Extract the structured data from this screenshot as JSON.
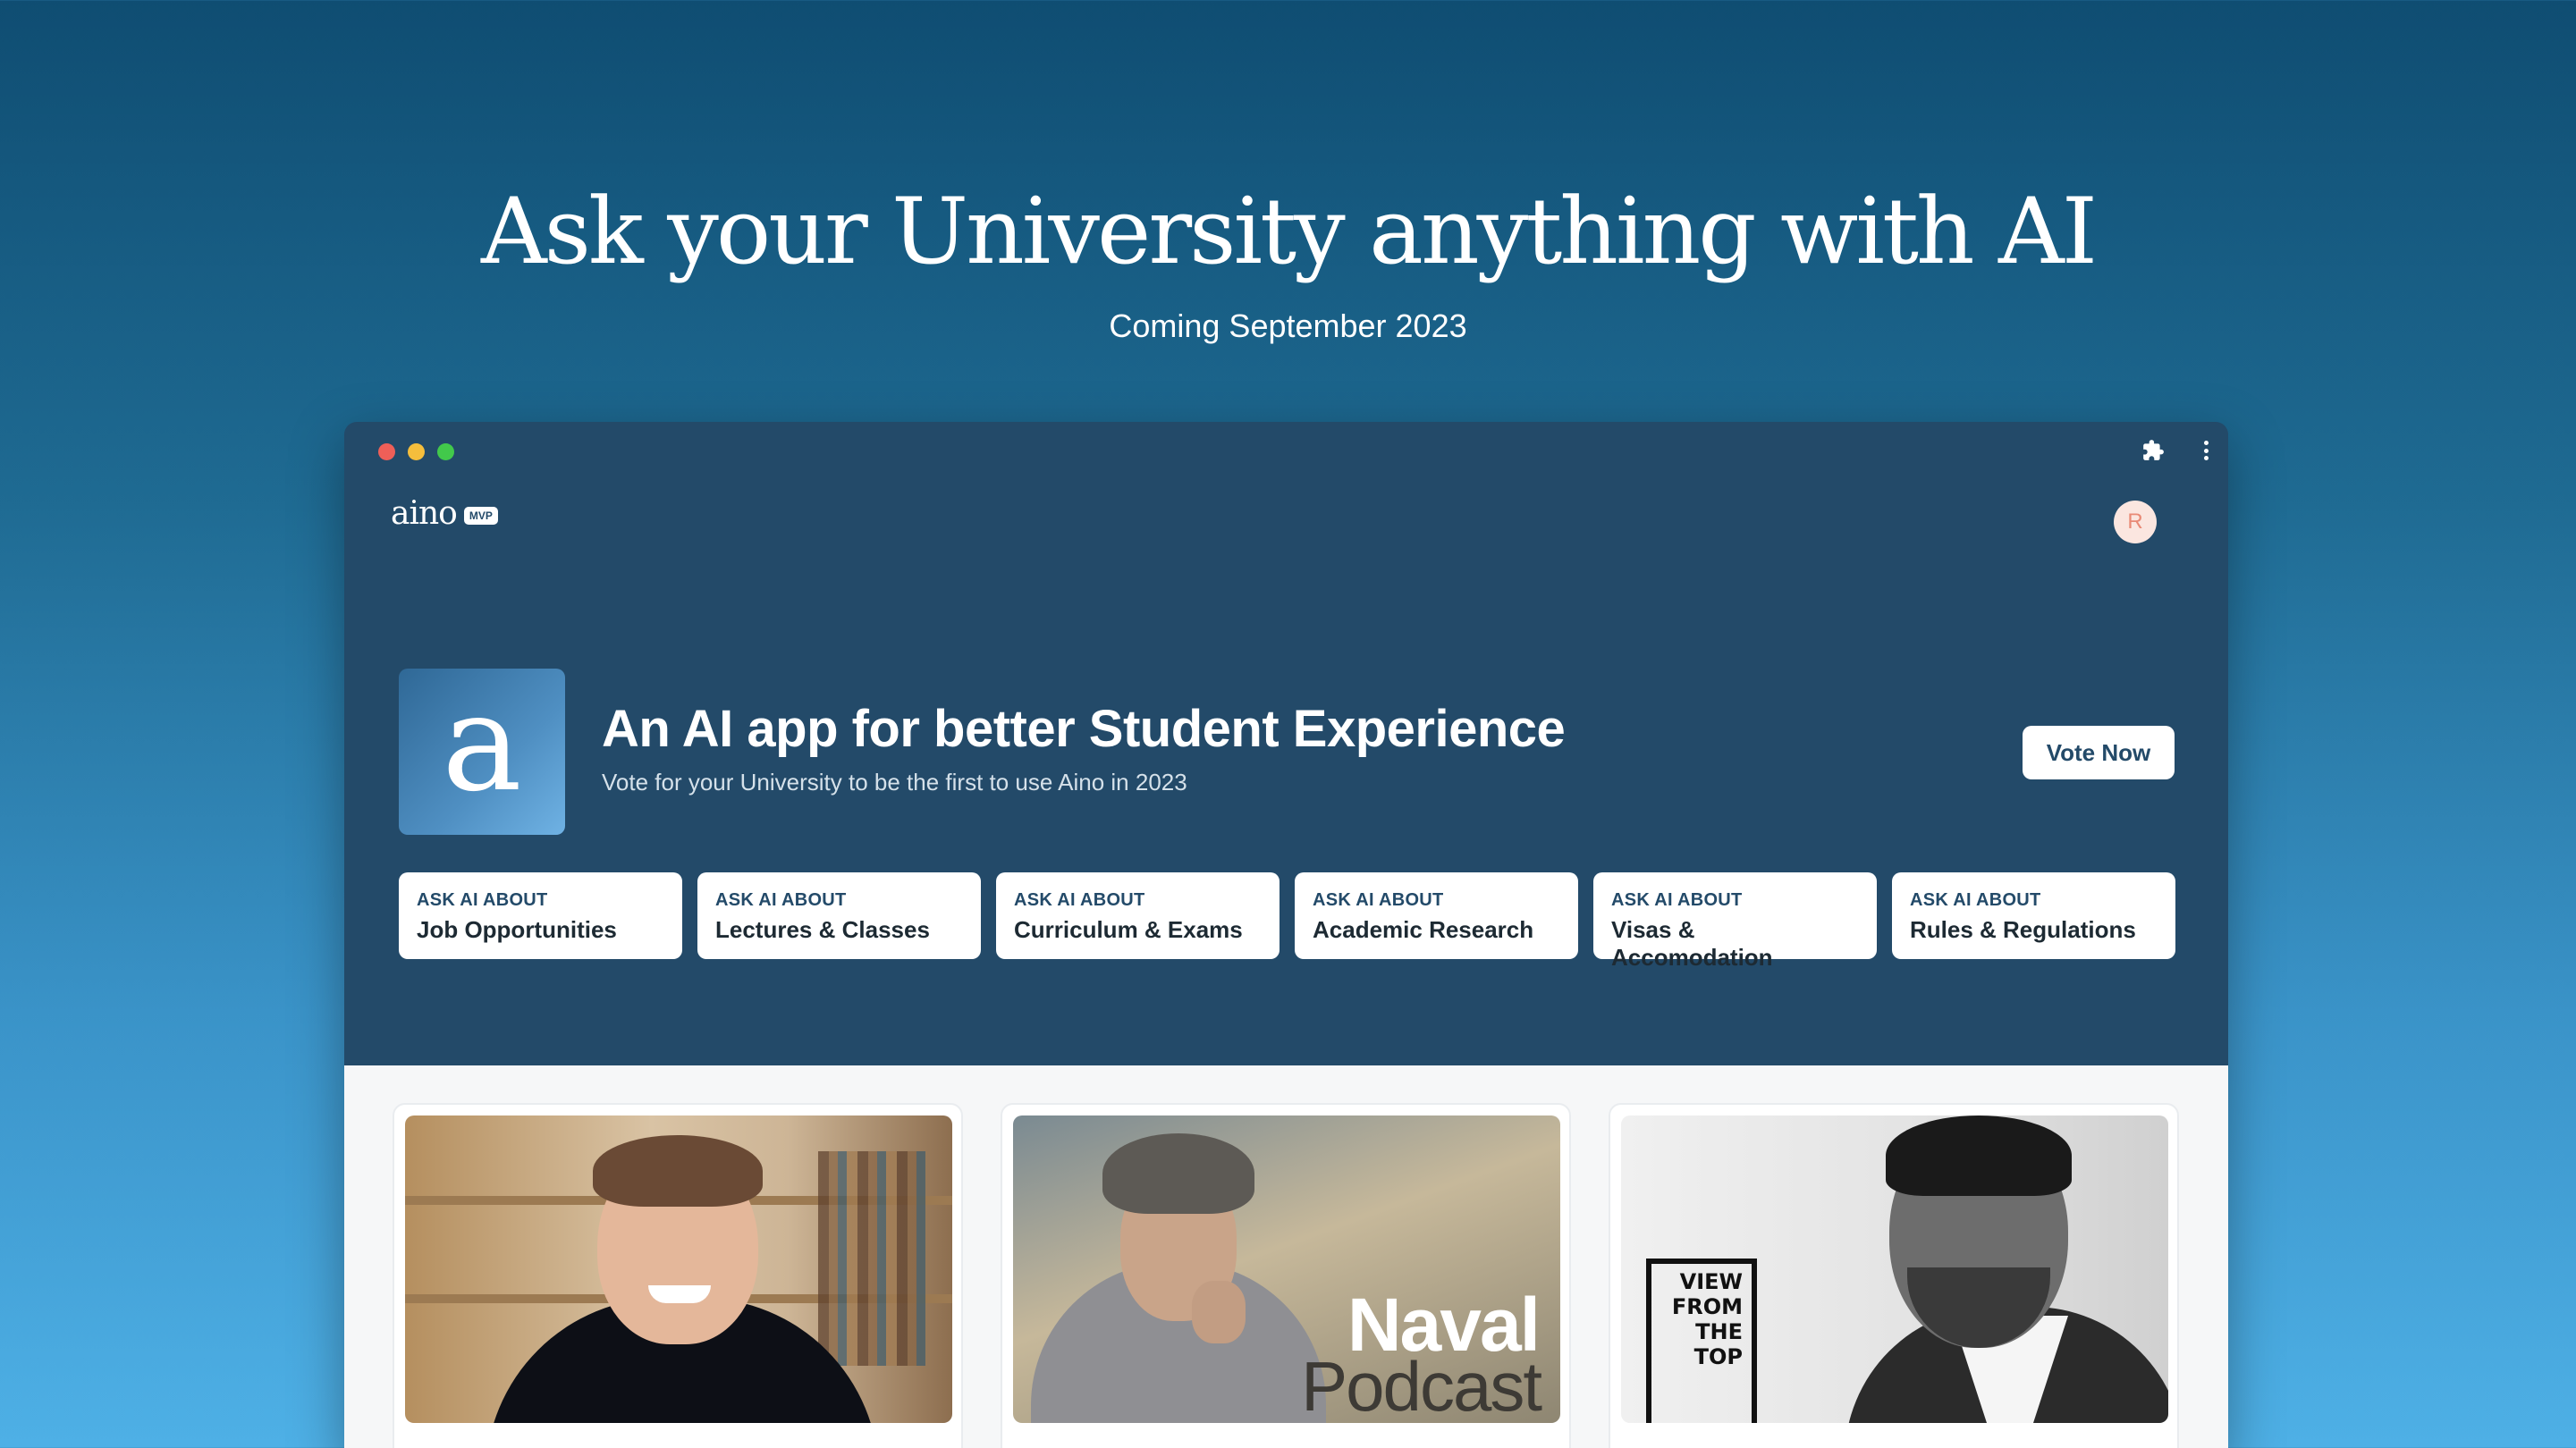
{
  "hero": {
    "title": "Ask your University anything with AI",
    "subtitle": "Coming September 2023"
  },
  "window": {
    "brand": "aino",
    "badge": "MVP",
    "avatar_initial": "R",
    "icons": [
      "puzzle-icon",
      "kebab-menu-icon"
    ]
  },
  "app": {
    "logo_letter": "a",
    "title": "An AI app for better Student Experience",
    "subtitle": "Vote for your University to be the first to use Aino in 2023",
    "vote_label": "Vote Now"
  },
  "topics": [
    {
      "kicker": "ASK AI ABOUT",
      "label": "Job Opportunities"
    },
    {
      "kicker": "ASK AI ABOUT",
      "label": "Lectures & Classes"
    },
    {
      "kicker": "ASK AI ABOUT",
      "label": "Curriculum & Exams"
    },
    {
      "kicker": "ASK AI ABOUT",
      "label": "Academic Research"
    },
    {
      "kicker": "ASK AI ABOUT",
      "label": "Visas & Accomodation"
    },
    {
      "kicker": "ASK AI ABOUT",
      "label": "Rules & Regulations"
    }
  ],
  "cards": [
    {
      "image": "person-bookshelf-photo"
    },
    {
      "image": "naval-podcast-cover",
      "text_line1": "Naval",
      "text_line2": "Podcast"
    },
    {
      "image": "view-from-the-top-portrait",
      "sign_lines": [
        "VIEW",
        "FROM",
        "THE",
        "TOP"
      ]
    }
  ],
  "colors": {
    "accent": "#234a69",
    "traffic_red": "#ee5f58",
    "traffic_yellow": "#f5be3c",
    "traffic_green": "#42c94b"
  }
}
